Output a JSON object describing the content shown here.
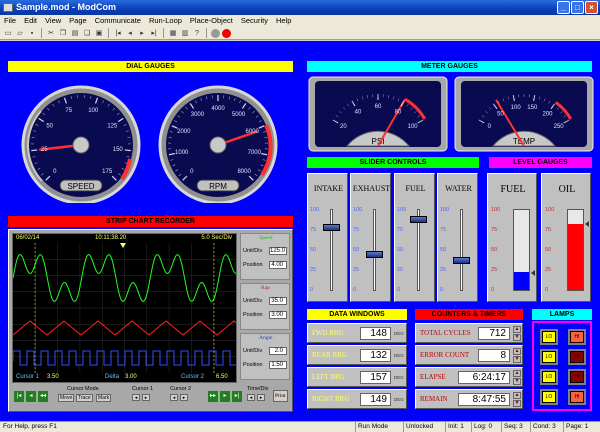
{
  "window": {
    "title": "Sample.mod - ModCom"
  },
  "menu": [
    "File",
    "Edit",
    "View",
    "Page",
    "Communicate",
    "Run-Loop",
    "Place-Object",
    "Security",
    "Help"
  ],
  "colors": {
    "workspace": "#0000ff",
    "yellow_banner": "#ffff00",
    "cyan_banner": "#00ffff",
    "green_banner": "#00ff00",
    "magenta_banner": "#ff00ff",
    "red_banner": "#ff0000"
  },
  "banners": {
    "dial_gauges": "DIAL GAUGES",
    "meter_gauges": "METER GAUGES",
    "strip_chart": "STRIP CHART RECORDER",
    "slider_controls": "SLIDER CONTROLS",
    "level_gauges": "LEVEL GAUGES",
    "data_windows": "DATA WINDOWS",
    "counters_timers": "COUNTERS & TIMERS",
    "lamps": "LAMPS"
  },
  "speed_gauge": {
    "label": "SPEED",
    "ticks": [
      "0",
      "25",
      "50",
      "75",
      "100",
      "125",
      "150",
      "175"
    ],
    "value": 25
  },
  "rpm_gauge": {
    "label": "RPM",
    "ticks": [
      "0",
      "1000",
      "2000",
      "3000",
      "4000",
      "5000",
      "6000",
      "7000",
      "8000"
    ],
    "value": 6100
  },
  "psi_meter": {
    "label": "PSI",
    "ticks": [
      "20",
      "40",
      "60",
      "80",
      "100"
    ],
    "value": 80
  },
  "temp_meter": {
    "label": "TEMP",
    "ticks": [
      "0",
      "50",
      "100",
      "150",
      "200",
      "250"
    ],
    "value": 60
  },
  "strip_chart": {
    "date": "06/02/14",
    "time": "10:11:38.20",
    "rate": "5.0 Sec/Div",
    "ch1": {
      "name": "Speed",
      "unitdiv_label": "Unit/Div",
      "unitdiv": "125.0",
      "pos_label": "Position",
      "pos": "4.00"
    },
    "ch2": {
      "name": "Rap",
      "unitdiv_label": "Unit/Div",
      "unitdiv": "35.0",
      "pos_label": "Position",
      "pos": "3.00"
    },
    "ch3": {
      "name": "Angle",
      "unitdiv_label": "Unit/Div",
      "unitdiv": "2.0",
      "pos_label": "Position",
      "pos": "1.50"
    },
    "cursor1_label": "Cursor 1",
    "cursor1": "3.50",
    "delta_label": "Delta",
    "delta": "3.00",
    "cursor2_label": "Cursor 2",
    "cursor2": "6.50",
    "cursor_mode_label": "Cursor Mode",
    "mode_btns": [
      "Move",
      "Trace",
      "Mark"
    ],
    "cursor1_nav": "Cursor 1",
    "cursor2_nav": "Cursor 2",
    "timediv_label": "Time/Div",
    "print_btn": "Print"
  },
  "sliders": [
    {
      "label": "INTAKE",
      "ticks": [
        "100",
        "75",
        "50",
        "25",
        "0"
      ],
      "value": 78
    },
    {
      "label": "EXHAUST",
      "ticks": [
        "100",
        "75",
        "50",
        "25",
        "0"
      ],
      "value": 45
    },
    {
      "label": "FUEL",
      "ticks": [
        "100",
        "75",
        "50",
        "25",
        "0"
      ],
      "value": 88
    },
    {
      "label": "WATER",
      "ticks": [
        "100",
        "75",
        "50",
        "25",
        "0"
      ],
      "value": 38
    }
  ],
  "levels": [
    {
      "label": "FUEL",
      "ticks": [
        "100",
        "75",
        "50",
        "25",
        "0"
      ],
      "value": 22,
      "color": "#0000ff"
    },
    {
      "label": "OIL",
      "ticks": [
        "100",
        "75",
        "50",
        "25",
        "0"
      ],
      "value": 82,
      "color": "#ff0000"
    }
  ],
  "data_windows": [
    {
      "label": "FWD BRG",
      "value": "148",
      "unit": "DEG"
    },
    {
      "label": "REAR BRG",
      "value": "132",
      "unit": "DEG"
    },
    {
      "label": "LEFT BRG",
      "value": "157",
      "unit": "DEG"
    },
    {
      "label": "RIGHT BRG",
      "value": "149",
      "unit": "DEG"
    }
  ],
  "counters": [
    {
      "label": "TOTAL CYCLES",
      "value": "712"
    },
    {
      "label": "ERROR COUNT",
      "value": "8"
    },
    {
      "label": "ELAPSE",
      "value": "6:24:17"
    },
    {
      "label": "REMAIN",
      "value": "8:47:55"
    }
  ],
  "lamps": [
    {
      "text": "LO",
      "color": "#ffff00"
    },
    {
      "text": "HI",
      "color": "#ff6040"
    },
    {
      "text": "LO",
      "color": "#ffff00"
    },
    {
      "text": "HI",
      "color": "#8b0000"
    },
    {
      "text": "LO",
      "color": "#ffff00"
    },
    {
      "text": "HI",
      "color": "#8b0000"
    },
    {
      "text": "LO",
      "color": "#ffff00"
    },
    {
      "text": "HI",
      "color": "#ff6040"
    }
  ],
  "status": {
    "help": "For Help, press F1",
    "mode": "Run Mode",
    "lock": "Unlocked",
    "init": "Init: 1",
    "log": "Log: 0",
    "seq": "Seq: 3",
    "cond": "Cond: 3",
    "page": "Page: 1"
  }
}
